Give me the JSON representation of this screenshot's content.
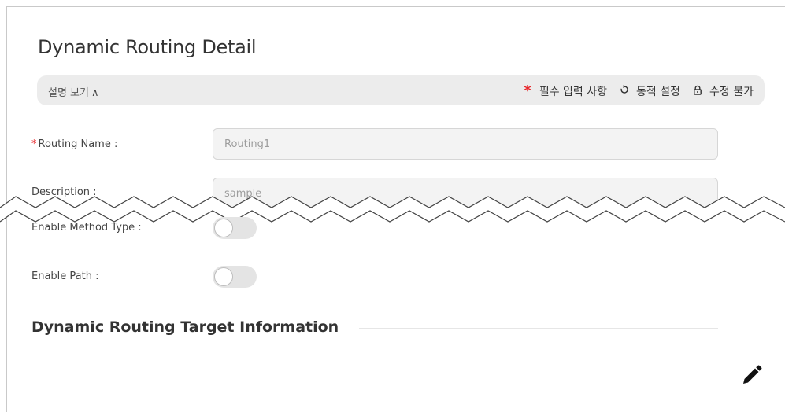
{
  "page": {
    "title": "Dynamic Routing Detail"
  },
  "info_bar": {
    "toggle_label": "설명 보기",
    "legend": {
      "required_symbol": "*",
      "required_label": "필수 입력 사항",
      "dynamic_symbol": "♢",
      "dynamic_label": "동적 설정",
      "locked_symbol": "🔒",
      "locked_label": "수정 불가"
    }
  },
  "form": {
    "routing_name": {
      "label": "Routing Name :",
      "value": "Routing1",
      "required": true
    },
    "description": {
      "label": "Description :",
      "value": "sample"
    },
    "enable_method_type": {
      "label": "Enable Method Type :",
      "on": false
    },
    "enable_path": {
      "label": "Enable Path :",
      "on": false
    }
  },
  "section": {
    "title": "Dynamic Routing Target Information"
  },
  "icons": {
    "caret": "chevron-up-icon",
    "dynamic": "refresh-icon",
    "locked": "lock-icon",
    "edit": "pencil-icon"
  },
  "colors": {
    "required": "#e8262a",
    "input_bg": "#f3f3f3",
    "info_bar_bg": "#ececec"
  }
}
